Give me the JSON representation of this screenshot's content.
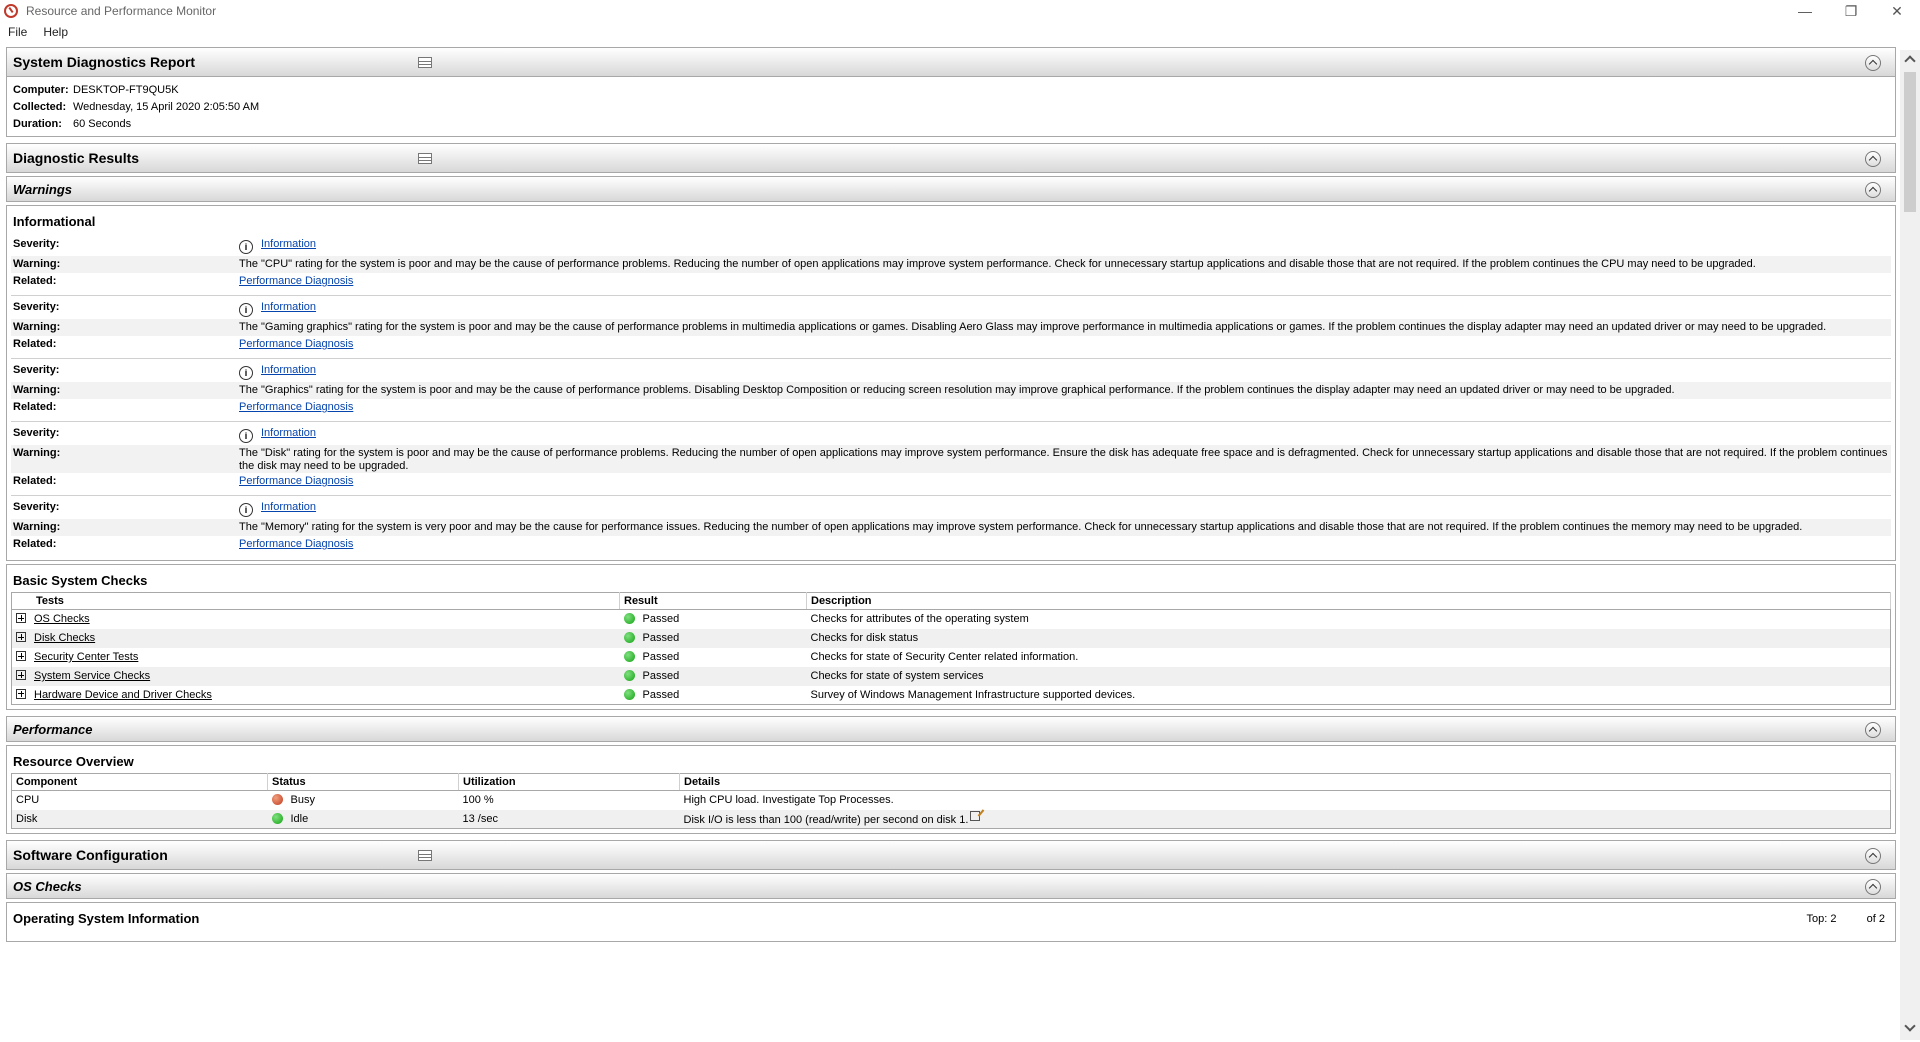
{
  "window": {
    "title": "Resource and Performance Monitor"
  },
  "menu": [
    "File",
    "Help"
  ],
  "report": {
    "title": "System Diagnostics Report",
    "computer_label": "Computer:",
    "computer": "DESKTOP-FT9QU5K",
    "collected_label": "Collected:",
    "collected": "Wednesday, 15 April 2020 2:05:50 AM",
    "duration_label": "Duration:",
    "duration": "60 Seconds"
  },
  "diagnostic_results": {
    "title": "Diagnostic Results"
  },
  "warnings": {
    "title": "Warnings"
  },
  "informational": {
    "title": "Informational",
    "severity_label": "Severity:",
    "warning_label": "Warning:",
    "related_label": "Related:",
    "items": [
      {
        "severity": "Information",
        "warning": "The \"CPU\" rating for the system is poor and may be the cause of performance problems. Reducing the number of open applications may improve system performance. Check for unnecessary startup applications and disable those that are not required. If the problem continues the CPU may need to be upgraded.",
        "related": "Performance Diagnosis"
      },
      {
        "severity": "Information",
        "warning": "The \"Gaming graphics\" rating for the system is poor and may be the cause of performance problems in multimedia applications or games. Disabling Aero Glass may improve performance in multimedia applications or games. If the problem continues the display adapter may need an updated driver or may need to be upgraded.",
        "related": "Performance Diagnosis"
      },
      {
        "severity": "Information",
        "warning": "The \"Graphics\" rating for the system is poor and may be the cause of performance problems. Disabling Desktop Composition or reducing screen resolution may improve graphical performance. If the problem continues the display adapter may need an updated driver or may need to be upgraded.",
        "related": "Performance Diagnosis"
      },
      {
        "severity": "Information",
        "warning": "The \"Disk\" rating for the system is poor and may be the cause of performance problems. Reducing the number of open applications may improve system performance. Ensure the disk has adequate free space and is defragmented. Check for unnecessary startup applications and disable those that are not required. If the problem continues the disk may need to be upgraded.",
        "related": "Performance Diagnosis"
      },
      {
        "severity": "Information",
        "warning": "The \"Memory\" rating for the system is very poor and may be the cause for performance issues. Reducing the number of open applications may improve system performance. Check for unnecessary startup applications and disable those that are not required. If the problem continues the memory may need to be upgraded.",
        "related": "Performance Diagnosis"
      }
    ]
  },
  "basic_checks": {
    "title": "Basic System Checks",
    "columns": [
      "Tests",
      "Result",
      "Description"
    ],
    "rows": [
      {
        "test": "OS Checks",
        "result": "Passed",
        "description": "Checks for attributes of the operating system"
      },
      {
        "test": "Disk Checks",
        "result": "Passed",
        "description": "Checks for disk status"
      },
      {
        "test": "Security Center Tests",
        "result": "Passed",
        "description": "Checks for state of Security Center related information."
      },
      {
        "test": "System Service Checks",
        "result": "Passed",
        "description": "Checks for state of system services"
      },
      {
        "test": "Hardware Device and Driver Checks",
        "result": "Passed",
        "description": "Survey of Windows Management Infrastructure supported devices."
      }
    ]
  },
  "performance": {
    "title": "Performance"
  },
  "resource_overview": {
    "title": "Resource Overview",
    "columns": [
      "Component",
      "Status",
      "Utilization",
      "Details"
    ],
    "rows": [
      {
        "component": "CPU",
        "status": "Busy",
        "utilization": "100 %",
        "details": "High CPU load. Investigate Top Processes.",
        "status_color": "#c0391b"
      },
      {
        "component": "Disk",
        "status": "Idle",
        "utilization": "13 /sec",
        "details": "Disk I/O is less than 100 (read/write) per second on disk 1.",
        "status_color": "#14a314"
      }
    ]
  },
  "software_config": {
    "title": "Software Configuration"
  },
  "os_checks": {
    "title": "OS Checks"
  },
  "os_info": {
    "title": "Operating System Information",
    "top_label": "Top: 2",
    "of_label": "of 2"
  }
}
